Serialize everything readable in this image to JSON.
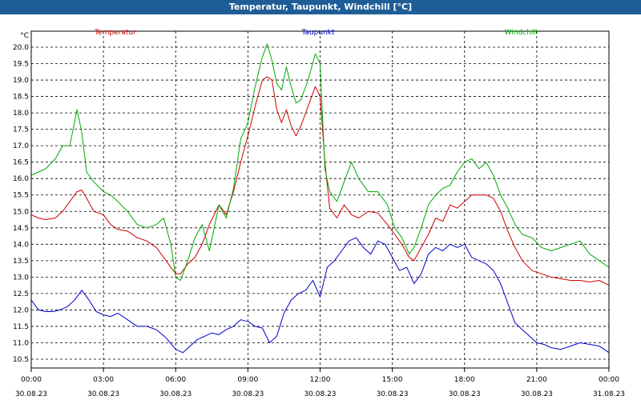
{
  "window": {
    "title": "Temperatur, Taupunkt, Windchill [°C]"
  },
  "chart_data": {
    "type": "line",
    "title": "Temperatur, Taupunkt, Windchill [°C]",
    "ylabel": "°C",
    "ylim": [
      10.5,
      20.0
    ],
    "yticks": [
      "10.5",
      "11.0",
      "11.5",
      "12.0",
      "12.5",
      "13.0",
      "13.5",
      "14.0",
      "14.5",
      "15.0",
      "15.5",
      "16.0",
      "16.5",
      "17.0",
      "17.5",
      "18.0",
      "18.5",
      "19.0",
      "19.5",
      "20.0"
    ],
    "xlim_hours": [
      0,
      24
    ],
    "xticks": [
      {
        "time": "00:00",
        "date": "30.08.23"
      },
      {
        "time": "03:00",
        "date": "30.08.23"
      },
      {
        "time": "06:00",
        "date": "30.08.23"
      },
      {
        "time": "09:00",
        "date": "30.08.23"
      },
      {
        "time": "12:00",
        "date": "30.08.23"
      },
      {
        "time": "15:00",
        "date": "30.08.23"
      },
      {
        "time": "18:00",
        "date": "30.08.23"
      },
      {
        "time": "21:00",
        "date": "30.08.23"
      },
      {
        "time": "00:00",
        "date": "31.08.23"
      }
    ],
    "grid": true,
    "legend_position": "top",
    "series": [
      {
        "name": "Temperatur",
        "color": "#cc0000",
        "x": [
          0,
          0.3,
          0.6,
          1,
          1.3,
          1.6,
          1.9,
          2.1,
          2.3,
          2.6,
          3,
          3.3,
          3.6,
          4,
          4.4,
          4.8,
          5.2,
          5.5,
          5.8,
          6,
          6.2,
          6.5,
          6.8,
          7.1,
          7.4,
          7.8,
          8.1,
          8.4,
          8.7,
          9,
          9.3,
          9.6,
          9.8,
          10,
          10.2,
          10.4,
          10.6,
          10.8,
          11,
          11.2,
          11.5,
          11.8,
          12,
          12.2,
          12.4,
          12.7,
          13,
          13.3,
          13.6,
          14,
          14.4,
          14.8,
          15.1,
          15.4,
          15.7,
          15.9,
          16.2,
          16.5,
          16.8,
          17.1,
          17.4,
          17.7,
          18,
          18.3,
          18.6,
          18.9,
          19.2,
          19.5,
          19.8,
          20.1,
          20.4,
          20.8,
          21.2,
          21.6,
          22,
          22.4,
          22.8,
          23.2,
          23.6,
          24
        ],
        "y": [
          14.9,
          14.8,
          14.75,
          14.8,
          15.0,
          15.3,
          15.6,
          15.65,
          15.4,
          15.0,
          14.9,
          14.6,
          14.45,
          14.4,
          14.2,
          14.1,
          13.9,
          13.6,
          13.3,
          13.1,
          13.1,
          13.4,
          13.6,
          14.0,
          14.6,
          15.2,
          14.9,
          15.6,
          16.5,
          17.3,
          18.2,
          19.0,
          19.1,
          19.0,
          18.1,
          17.7,
          18.1,
          17.6,
          17.3,
          17.6,
          18.2,
          18.8,
          18.5,
          16.5,
          15.1,
          14.8,
          15.2,
          14.9,
          14.8,
          15.0,
          14.95,
          14.6,
          14.3,
          14.0,
          13.6,
          13.5,
          13.9,
          14.3,
          14.8,
          14.7,
          15.2,
          15.1,
          15.3,
          15.5,
          15.5,
          15.5,
          15.4,
          15.0,
          14.4,
          13.9,
          13.5,
          13.2,
          13.1,
          13.0,
          12.95,
          12.9,
          12.9,
          12.85,
          12.9,
          12.75
        ]
      },
      {
        "name": "Taupunkt",
        "color": "#0000cc",
        "x": [
          0,
          0.3,
          0.6,
          0.9,
          1.2,
          1.5,
          1.8,
          2.1,
          2.4,
          2.7,
          3,
          3.3,
          3.6,
          4,
          4.4,
          4.8,
          5.2,
          5.6,
          6,
          6.3,
          6.6,
          6.9,
          7.2,
          7.5,
          7.8,
          8.1,
          8.4,
          8.7,
          9,
          9.3,
          9.6,
          9.9,
          10.2,
          10.5,
          10.8,
          11.1,
          11.4,
          11.7,
          12,
          12.3,
          12.6,
          12.9,
          13.2,
          13.5,
          13.8,
          14.1,
          14.4,
          14.7,
          15,
          15.3,
          15.6,
          15.9,
          16.2,
          16.5,
          16.8,
          17.1,
          17.4,
          17.7,
          18,
          18.3,
          18.6,
          18.9,
          19.2,
          19.5,
          19.8,
          20.1,
          20.4,
          20.7,
          21,
          21.3,
          21.6,
          22,
          22.4,
          22.8,
          23.2,
          23.6,
          24
        ],
        "y": [
          12.3,
          12.0,
          11.95,
          11.95,
          12.0,
          12.1,
          12.3,
          12.6,
          12.3,
          11.95,
          11.85,
          11.8,
          11.9,
          11.7,
          11.5,
          11.5,
          11.4,
          11.15,
          10.8,
          10.7,
          10.9,
          11.1,
          11.2,
          11.3,
          11.25,
          11.4,
          11.5,
          11.7,
          11.65,
          11.5,
          11.45,
          11.0,
          11.2,
          11.9,
          12.3,
          12.5,
          12.6,
          12.9,
          12.4,
          13.3,
          13.5,
          13.8,
          14.1,
          14.2,
          13.9,
          13.7,
          14.1,
          14.0,
          13.6,
          13.2,
          13.3,
          12.8,
          13.1,
          13.7,
          13.9,
          13.8,
          14.0,
          13.9,
          14.0,
          13.6,
          13.5,
          13.4,
          13.2,
          12.8,
          12.2,
          11.6,
          11.4,
          11.2,
          11.0,
          10.95,
          10.85,
          10.8,
          10.9,
          11.0,
          10.95,
          10.9,
          10.7
        ]
      },
      {
        "name": "Windchill",
        "color": "#00aa00",
        "x": [
          0,
          0.3,
          0.6,
          1,
          1.3,
          1.6,
          1.9,
          2.1,
          2.3,
          2.6,
          3,
          3.3,
          3.6,
          4,
          4.4,
          4.8,
          5.2,
          5.5,
          5.8,
          6,
          6.2,
          6.5,
          6.8,
          7.1,
          7.4,
          7.8,
          8.1,
          8.4,
          8.7,
          9,
          9.3,
          9.6,
          9.8,
          10,
          10.2,
          10.4,
          10.6,
          10.8,
          11,
          11.2,
          11.5,
          11.8,
          12,
          12.2,
          12.4,
          12.7,
          13,
          13.3,
          13.6,
          14,
          14.4,
          14.8,
          15.1,
          15.4,
          15.7,
          15.9,
          16.2,
          16.5,
          16.8,
          17.1,
          17.4,
          17.7,
          18,
          18.3,
          18.6,
          18.9,
          19.2,
          19.5,
          19.8,
          20.1,
          20.4,
          20.8,
          21.2,
          21.6,
          22,
          22.4,
          22.8,
          23.2,
          23.6,
          24
        ],
        "y": [
          16.1,
          16.2,
          16.3,
          16.6,
          17.0,
          17.0,
          18.1,
          17.4,
          16.2,
          15.9,
          15.6,
          15.5,
          15.3,
          15.0,
          14.6,
          14.5,
          14.6,
          14.8,
          14.0,
          13.0,
          12.9,
          13.5,
          14.2,
          14.6,
          13.8,
          15.2,
          14.8,
          15.7,
          17.2,
          17.7,
          18.8,
          19.7,
          20.1,
          19.6,
          18.9,
          18.7,
          19.4,
          18.8,
          18.3,
          18.4,
          19.0,
          19.8,
          19.5,
          16.3,
          15.6,
          15.3,
          15.9,
          16.5,
          16.0,
          15.6,
          15.6,
          15.2,
          14.5,
          14.2,
          13.7,
          13.9,
          14.5,
          15.2,
          15.5,
          15.7,
          15.8,
          16.2,
          16.5,
          16.6,
          16.3,
          16.5,
          16.1,
          15.5,
          15.1,
          14.6,
          14.3,
          14.2,
          13.9,
          13.8,
          13.9,
          14.0,
          14.1,
          13.7,
          13.5,
          13.3
        ]
      }
    ]
  }
}
